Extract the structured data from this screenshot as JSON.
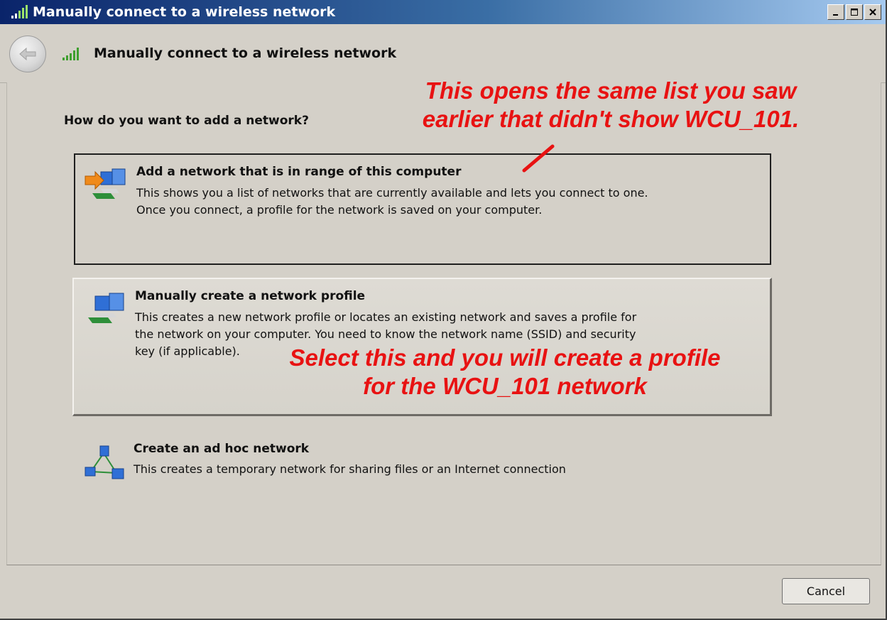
{
  "window": {
    "title": "Manually connect to a wireless network",
    "controls": [
      "minimize",
      "maximize",
      "close"
    ]
  },
  "nav": {
    "title": "Manually connect to a wireless network",
    "back_icon": "back-arrow-icon"
  },
  "main": {
    "prompt": "How do you want to add a network?",
    "options": [
      {
        "title": "Add a network that is in range of this computer",
        "description": "This shows you a list of networks that are currently available and lets you connect to one.\nOnce you connect, a profile for the network is saved on your computer.",
        "icon": "network-add-arrow-icon"
      },
      {
        "title": "Manually create a network profile",
        "description": "This creates a new network profile or locates an existing network and saves a profile for\nthe network on your computer. You need to know the network name (SSID) and security\nkey (if applicable).",
        "icon": "network-computers-icon"
      },
      {
        "title": "Create an ad hoc network",
        "description": "This creates a temporary network for sharing files or an Internet connection",
        "icon": "ad-hoc-network-icon"
      }
    ]
  },
  "annotations": {
    "top": "This opens the same list you saw\nearlier that didn't show WCU_101.",
    "middle": "Select this and you will create a profile\nfor the WCU_101 network",
    "color": "#e81212"
  },
  "footer": {
    "cancel_label": "Cancel"
  }
}
